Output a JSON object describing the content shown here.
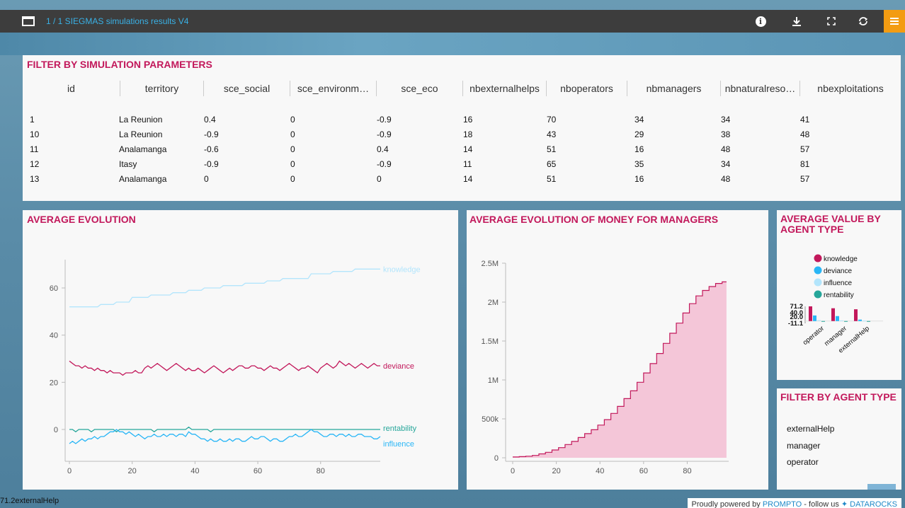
{
  "topbar": {
    "title": "1 / 1 SIEGMAS simulations results V4",
    "buttons": [
      "info-icon",
      "download-icon",
      "fullscreen-icon",
      "refresh-icon",
      "menu-icon"
    ]
  },
  "filter_table": {
    "title": "FILTER BY SIMULATION PARAMETERS",
    "columns": [
      "id",
      "territory",
      "sce_social",
      "sce_environm…",
      "sce_eco",
      "nbexternalhelps",
      "nboperators",
      "nbmanagers",
      "nbnaturalreso…",
      "nbexploitations"
    ],
    "rows": [
      [
        "1",
        "La Reunion",
        "0.4",
        "0",
        "-0.9",
        "16",
        "70",
        "34",
        "34",
        "41"
      ],
      [
        "10",
        "La Reunion",
        "-0.9",
        "0",
        "-0.9",
        "18",
        "43",
        "29",
        "38",
        "48"
      ],
      [
        "11",
        "Analamanga",
        "-0.6",
        "0",
        "0.4",
        "14",
        "51",
        "16",
        "48",
        "57"
      ],
      [
        "12",
        "Itasy",
        "-0.9",
        "0",
        "-0.9",
        "11",
        "65",
        "35",
        "34",
        "81"
      ],
      [
        "13",
        "Analamanga",
        "0",
        "0",
        "0",
        "14",
        "51",
        "16",
        "48",
        "57"
      ]
    ]
  },
  "avg_evolution": {
    "title": "AVERAGE EVOLUTION"
  },
  "money_managers": {
    "title": "AVERAGE EVOLUTION OF MONEY FOR MANAGERS"
  },
  "agent_value": {
    "title": "AVERAGE VALUE BY AGENT TYPE"
  },
  "agent_filter": {
    "title": "FILTER BY AGENT TYPE",
    "items": [
      "externalHelp",
      "manager",
      "operator"
    ]
  },
  "footer": {
    "left_text": "71.2externalHelp",
    "powered_prefix": "Proudly powered by ",
    "powered_link": "PROMPTO",
    "follow_text": " - follow us ",
    "follow_link": "DATAROCKS"
  },
  "colors": {
    "accent": "#c2185b",
    "knowledge": "#b3e5fc",
    "deviance": "#c2185b",
    "rentability": "#26a69a",
    "influence": "#29b6f6",
    "area": "#f4c6d8",
    "menu": "#f39c12"
  },
  "chart_data": [
    {
      "type": "line",
      "xlim": [
        0,
        99
      ],
      "ylim": [
        -12,
        72
      ],
      "xticks": [
        "0",
        "20",
        "40",
        "60",
        "80"
      ],
      "yticks": [
        "0",
        "20",
        "40",
        "60"
      ],
      "series": [
        {
          "name": "knowledge",
          "color": "#b3e5fc",
          "values": [
            52,
            52,
            52,
            52,
            52,
            52,
            52,
            52,
            52,
            52,
            53,
            53,
            53,
            53,
            53,
            54,
            54,
            54,
            54,
            54,
            56,
            56,
            56,
            56,
            56,
            56,
            57,
            57,
            57,
            57,
            57,
            57,
            57,
            58,
            58,
            58,
            58,
            58,
            59,
            59,
            59,
            59,
            59,
            60,
            60,
            60,
            60,
            60,
            60,
            61,
            61,
            61,
            61,
            61,
            61,
            61,
            62,
            62,
            62,
            62,
            62,
            62,
            62,
            63,
            63,
            63,
            63,
            63,
            64,
            64,
            64,
            64,
            64,
            64,
            64,
            64,
            64,
            66,
            66,
            66,
            66,
            66,
            66,
            66,
            67,
            67,
            67,
            67,
            67,
            67,
            67,
            68,
            68,
            68,
            68,
            68,
            68,
            68,
            68,
            68
          ]
        },
        {
          "name": "deviance",
          "color": "#c2185b",
          "values": [
            29,
            28,
            27,
            27,
            26,
            27,
            26,
            26,
            25,
            26,
            25,
            25,
            24,
            25,
            24,
            24,
            24,
            23,
            24,
            24,
            24,
            25,
            24,
            24,
            26,
            27,
            26,
            27,
            28,
            27,
            26,
            25,
            26,
            27,
            28,
            27,
            26,
            25,
            26,
            25,
            25,
            26,
            25,
            24,
            25,
            26,
            27,
            26,
            25,
            24,
            25,
            26,
            25,
            26,
            27,
            27,
            26,
            26,
            27,
            27,
            26,
            26,
            25,
            26,
            27,
            26,
            26,
            25,
            26,
            27,
            28,
            27,
            26,
            25,
            26,
            26,
            27,
            26,
            25,
            24,
            26,
            27,
            28,
            27,
            26,
            27,
            29,
            28,
            27,
            28,
            27,
            26,
            27,
            28,
            27,
            26,
            27,
            28,
            27,
            27
          ]
        },
        {
          "name": "rentability",
          "color": "#26a69a",
          "values": [
            0,
            0,
            -1,
            0,
            0,
            0,
            0,
            -1,
            0,
            0,
            0,
            0,
            0,
            0,
            0,
            -1,
            0,
            0,
            0,
            0,
            0,
            0,
            0,
            0,
            0,
            0,
            0,
            -1,
            0,
            0,
            0,
            0,
            0,
            0,
            0,
            0,
            0,
            0,
            1,
            0,
            0,
            0,
            0,
            0,
            0,
            -1,
            0,
            0,
            0,
            0,
            0,
            0,
            0,
            0,
            0,
            0,
            0,
            0,
            0,
            0,
            0,
            0,
            0,
            0,
            0,
            0,
            0,
            0,
            0,
            0,
            0,
            0,
            0,
            0,
            0,
            0,
            0,
            0,
            0,
            0,
            0,
            0,
            0,
            0,
            0,
            0,
            0,
            0,
            0,
            0,
            0,
            0,
            0,
            0,
            0,
            0,
            0,
            0,
            0,
            0
          ]
        },
        {
          "name": "influence",
          "color": "#29b6f6",
          "values": [
            -6,
            -5,
            -6,
            -5,
            -4,
            -5,
            -4,
            -4,
            -3,
            -4,
            -3,
            -3,
            -2,
            -1,
            -1,
            0,
            -1,
            -1,
            -2,
            -1,
            -2,
            -3,
            -2,
            -3,
            -4,
            -3,
            -3,
            -2,
            -3,
            -3,
            -2,
            -3,
            -2,
            -2,
            -3,
            -2,
            -2,
            -3,
            -1,
            -2,
            -2,
            -3,
            -4,
            -4,
            -5,
            -4,
            -5,
            -5,
            -4,
            -5,
            -5,
            -4,
            -5,
            -4,
            -4,
            -5,
            -5,
            -4,
            -3,
            -4,
            -4,
            -3,
            -3,
            -4,
            -5,
            -4,
            -4,
            -5,
            -5,
            -4,
            -3,
            -3,
            -2,
            -3,
            -3,
            -2,
            -1,
            0,
            -1,
            -1,
            -2,
            -3,
            -3,
            -2,
            -2,
            -3,
            -2,
            -2,
            -3,
            -2,
            -3,
            -3,
            -2,
            -2,
            -3,
            -3,
            -3,
            -4,
            -4,
            -3
          ]
        }
      ]
    },
    {
      "type": "area",
      "xlim": [
        0,
        99
      ],
      "ylim": [
        0,
        2500000
      ],
      "xticks": [
        "0",
        "20",
        "40",
        "60",
        "80"
      ],
      "yticks": [
        "0",
        "500k",
        "1M",
        "1.5M",
        "2M",
        "2.5M"
      ],
      "series": [
        {
          "name": "",
          "color": "#f4c6d8",
          "x": [
            0,
            3,
            6,
            9,
            12,
            15,
            18,
            21,
            24,
            27,
            30,
            33,
            36,
            39,
            42,
            45,
            48,
            51,
            54,
            57,
            60,
            63,
            66,
            69,
            72,
            75,
            78,
            81,
            84,
            87,
            90,
            93,
            96,
            98
          ],
          "values": [
            10000,
            15000,
            20000,
            30000,
            50000,
            70000,
            100000,
            130000,
            170000,
            210000,
            260000,
            310000,
            360000,
            420000,
            490000,
            570000,
            660000,
            760000,
            860000,
            970000,
            1090000,
            1210000,
            1340000,
            1470000,
            1600000,
            1730000,
            1860000,
            1980000,
            2080000,
            2150000,
            2200000,
            2240000,
            2260000,
            2260000
          ]
        }
      ]
    },
    {
      "type": "bar",
      "categories": [
        "operator",
        "manager",
        "externalHelp"
      ],
      "yticks": [
        "71.2",
        "40.0",
        "20.0",
        "-11.1"
      ],
      "ylim": [
        -11.1,
        71.2
      ],
      "legend": [
        "knowledge",
        "deviance",
        "influence",
        "rentability"
      ],
      "series": [
        {
          "name": "knowledge",
          "color": "#c2185b",
          "values": [
            71.2,
            62,
            57
          ]
        },
        {
          "name": "deviance",
          "color": "#29b6f6",
          "values": [
            27,
            24,
            7
          ]
        },
        {
          "name": "influence",
          "color": "#b3e5fc",
          "values": [
            4,
            3,
            2
          ]
        },
        {
          "name": "rentability",
          "color": "#26a69a",
          "values": [
            0,
            0,
            0
          ]
        }
      ]
    }
  ]
}
